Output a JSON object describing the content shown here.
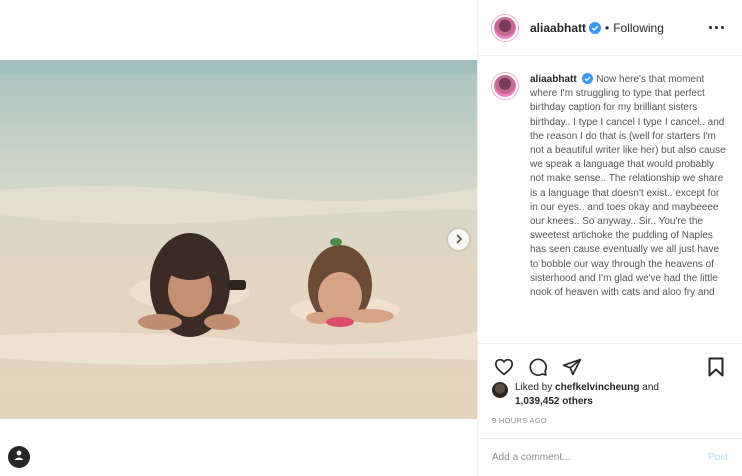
{
  "post": {
    "username": "aliaabhatt",
    "separator": "•",
    "follow_status": "Following",
    "caption_username": "aliaabhatt",
    "caption": "Now here's that moment where I'm struggling to type that perfect birthday caption for my brilliant sisters birthday.. I type I cancel I type I cancel.. and the reason I do that is (well for starters I'm not a beautiful writer like her) but also cause we speak a language that would probably not make sense.. The relationship we share is a language that doesn't exist.. except for in our eyes.. and toes okay and maybeeee our knees.. So anyway.. Sir.. You're the sweetest artichoke the pudding of Naples has seen cause eventually we all just have to bobble our way through the heavens of sisterhood and I'm glad we've had the little nook of heaven with cats and aloo fry and",
    "likes_prefix": "Liked by",
    "liked_by_user": "chefkelvincheung",
    "likes_and": "and",
    "likes_count": "1,039,452 others",
    "timestamp": "9 HOURS AGO",
    "comment_placeholder": "Add a comment...",
    "post_label": "Post"
  },
  "icons": {
    "verified": "verified-badge-icon",
    "more": "more-options-icon",
    "like": "heart-icon",
    "comment": "comment-icon",
    "share": "share-icon",
    "save": "bookmark-icon",
    "next": "chevron-right-icon",
    "tag": "user-tag-icon"
  },
  "colors": {
    "verified_blue": "#3897f0",
    "post_button": "#b2dffc",
    "secondary_text": "#8e8e8e"
  }
}
